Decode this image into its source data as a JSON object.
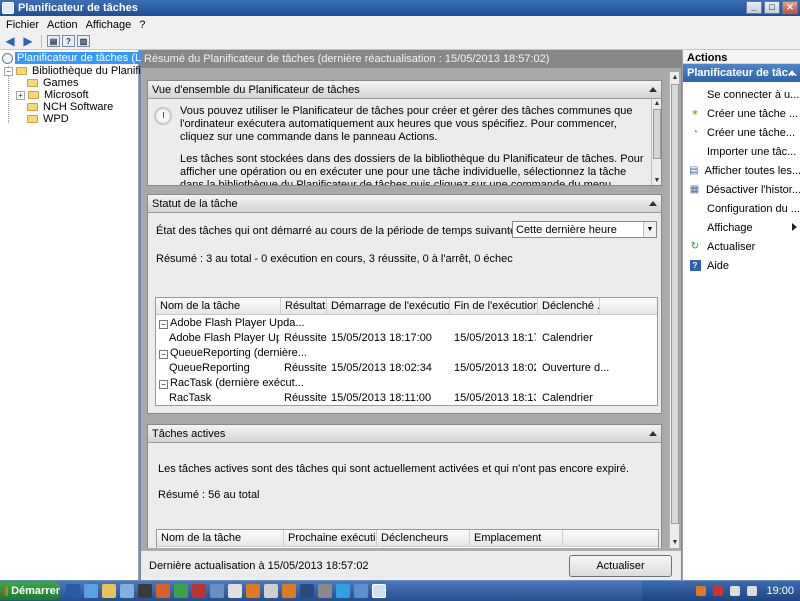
{
  "window": {
    "title": "Planificateur de tâches"
  },
  "menu": [
    "Fichier",
    "Action",
    "Affichage",
    "?"
  ],
  "tree": {
    "root": "Planificateur de tâches (Local)",
    "library": "Bibliothèque du Planificateur",
    "children": [
      "Games",
      "Microsoft",
      "NCH Software",
      "WPD"
    ]
  },
  "center": {
    "header": "Résumé du Planificateur de tâches (dernière réactualisation : 15/05/2013 18:57:02)",
    "overview": {
      "title": "Vue d'ensemble du Planificateur de tâches",
      "p1": "Vous pouvez utiliser le Planificateur de tâches pour créer et gérer des tâches communes que l'ordinateur exécutera automatiquement aux heures que vous spécifiez. Pour commencer, cliquez sur une commande dans le panneau Actions.",
      "p2": "Les tâches sont stockées dans des dossiers de la bibliothèque du Planificateur de tâches. Pour afficher une opération ou en exécuter une pour une tâche individuelle, sélectionnez la tâche dans la bibliothèque du Planificateur de tâches puis cliquez sur une commande du menu Actions."
    },
    "status": {
      "title": "Statut de la tâche",
      "period_label": "État des tâches qui ont démarré au cours de la période de temps suivante :",
      "period_value": "Cette dernière heure",
      "summary": "Résumé : 3 au total - 0 exécution en cours, 3 réussite, 0 à l'arrêt, 0 échec",
      "columns": [
        "Nom de la tâche",
        "Résultat...",
        "Démarrage de l'exécution",
        "Fin de l'exécution",
        "Déclenché ..."
      ],
      "rows": [
        {
          "group": "Adobe Flash Player Upda...",
          "name": "Adobe Flash Player Upda...",
          "result": "Réussite",
          "start": "15/05/2013 18:17:00",
          "end": "15/05/2013 18:17:...",
          "trigger": "Calendrier"
        },
        {
          "group": "QueueReporting (dernière...",
          "name": "QueueReporting",
          "result": "Réussite",
          "start": "15/05/2013 18:02:34",
          "end": "15/05/2013 18:02:...",
          "trigger": "Ouverture d..."
        },
        {
          "group": "RacTask (dernière exécut...",
          "name": "RacTask",
          "result": "Réussite",
          "start": "15/05/2013 18:11:00",
          "end": "15/05/2013 18:13:...",
          "trigger": "Calendrier"
        }
      ]
    },
    "active": {
      "title": "Tâches actives",
      "description": "Les tâches actives sont des tâches qui sont actuellement activées et qui n'ont pas encore expiré.",
      "summary": "Résumé : 56 au total",
      "columns": [
        "Nom de la tâche",
        "Prochaine exécution",
        "Déclencheurs",
        "Emplacement"
      ]
    },
    "footer": {
      "last_update": "Dernière actualisation à 15/05/2013 18:57:02",
      "refresh_button": "Actualiser"
    }
  },
  "actions": {
    "title": "Actions",
    "group": "Planificateur de tâc...",
    "items": [
      "Se connecter à u...",
      "Créer une tâche ...",
      "Créer une tâche...",
      "Importer une tâc...",
      "Afficher toutes les...",
      "Désactiver l'histor...",
      "Configuration du ...",
      "Affichage",
      "Actualiser",
      "Aide"
    ]
  },
  "taskbar": {
    "start": "Démarrer",
    "clock": "19:00"
  }
}
